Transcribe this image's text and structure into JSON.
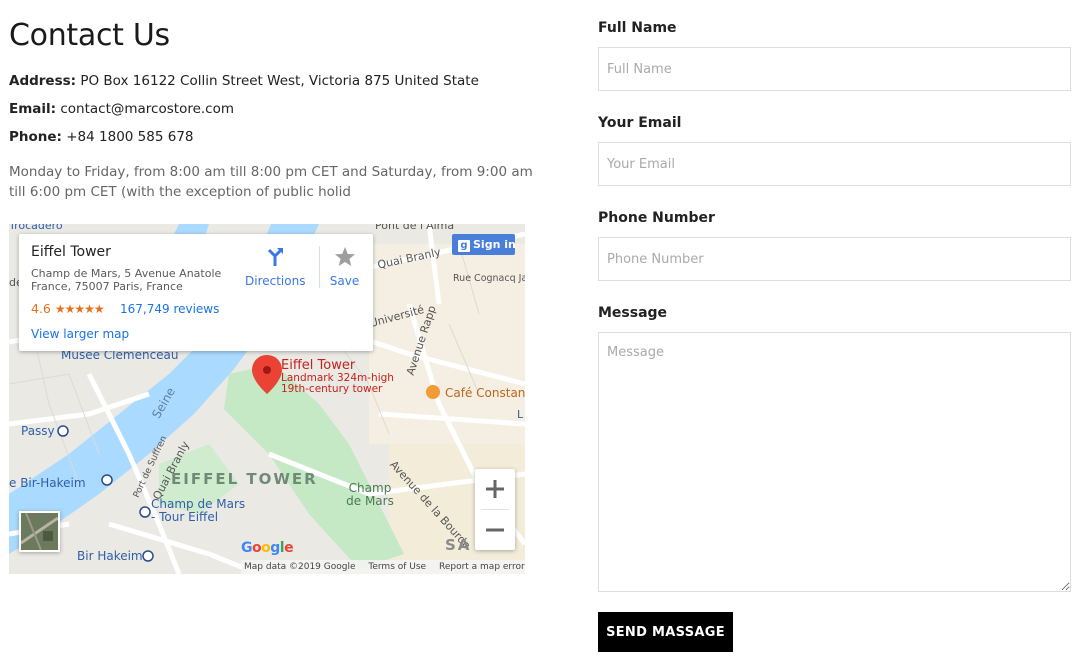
{
  "contact": {
    "title": "Contact Us",
    "address_label": "Address:",
    "address_value": "PO Box 16122 Collin Street West, Victoria 875 United State",
    "email_label": "Email:",
    "email_value": "contact@marcostore.com",
    "phone_label": "Phone:",
    "phone_value": "+84 1800 585 678",
    "hours_line1": "Monday to Friday, from 8:00 am till 8:00 pm CET and Saturday, from 9:00 am",
    "hours_line2": "till 6:00 pm CET (with the exception of public holid"
  },
  "map": {
    "card": {
      "title": "Eiffel Tower",
      "address": "Champ de Mars, 5 Avenue Anatole France, 75007 Paris, France",
      "rating": "4.6",
      "stars": "★★★★★",
      "reviews": "167,749 reviews",
      "larger_map": "View larger map",
      "directions": "Directions",
      "save": "Save"
    },
    "sign_in": "Sign in",
    "pin_title": "Eiffel Tower",
    "pin_sub1": "Landmark 324m-high",
    "pin_sub2": "19th-century tower",
    "labels": {
      "trocadero": "Trocadéro",
      "pont_alma": "Pont de l'Alma",
      "quai_branly_top": "Quai Branly",
      "rue_cognacq": "Rue Cognacq Jay",
      "universite": "Université",
      "avenue_rapp": "Avenue Rapp",
      "musee": "Musée Clemenceau",
      "cafe": "Café Constant",
      "seine": "Seine",
      "passy": "Passy",
      "quai_branly_left": "Quai Branly",
      "port_suffren": "Port de Suffren",
      "bir_hakeim_top": "e Bir-Hakeim",
      "eiffel_big": "EIFFEL TOWER",
      "champ_mars": "Champ de Mars",
      "champ_station": "Champ de Mars - Tour Eiffel",
      "avenue_bourdonnais": "Avenue de la Bourdo",
      "bir_hakeim_bottom": "Bir Hakeim",
      "saint": "SA",
      "left_de": "de",
      "right_l": "L"
    },
    "google": "Google",
    "attribution": {
      "data": "Map data ©2019 Google",
      "terms": "Terms of Use",
      "report": "Report a map error"
    }
  },
  "form": {
    "full_name_label": "Full Name",
    "full_name_placeholder": "Full Name",
    "email_label": "Your Email",
    "email_placeholder": "Your Email",
    "phone_label": "Phone Number",
    "phone_placeholder": "Phone Number",
    "message_label": "Message",
    "message_placeholder": "Message",
    "submit": "SEND MASSAGE"
  },
  "colors": {
    "accent_button": "#000000",
    "map_water": "#aadaff",
    "map_park": "#c5e8c5",
    "map_pin": "#ea4335"
  }
}
